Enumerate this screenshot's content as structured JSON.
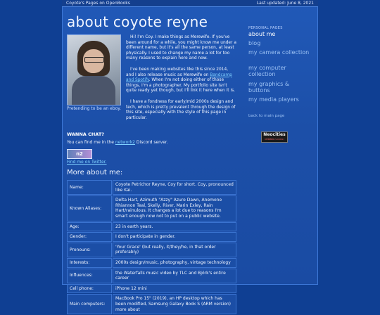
{
  "topbar": {
    "left": "Coyote's Pages on OpenBooks",
    "right": "Last updated: June 8, 2021"
  },
  "title": "about coyote reyne",
  "photo_caption": "Pretending to be an eboy.",
  "intro": {
    "p1": "Hi! I'm Coy. I make things as Merewife. If you've been around for a while, you might know me under a different name, but it's all the same person, at least physically. I used to change my name a lot for too many reasons to explain here and now.",
    "p2_a": "I've been making websites like this since 2014, and I also release music as Merewife on ",
    "p2_link": "Bandcamp and Spotify",
    "p2_b": ". When I'm not doing either of those things, I'm a photographer. My portfolio site isn't quite ready yet though, but I'll link it here when it is.",
    "p3": "I have a fondness for early/mid 2000s design and tech, which is pretty prevalent through the design of this site, especially with the style of this page in particular."
  },
  "chat": {
    "heading": "WANNA CHAT?",
    "text_a": "You can find me in the ",
    "link": "network2",
    "text_b": " Discord server.",
    "badge": "n2",
    "twitter": "Find me on Twitter."
  },
  "more_heading": "More about me:",
  "table": [
    {
      "k": "Name:",
      "v": "Coyote Petrichor Reyne, Coy for short. Coy, pronounced like Kai."
    },
    {
      "k": "Known Aliases:",
      "v": "Delta Hart, Azimuth \"Azzy\" Azure Dawn, Anemone Rhiannon Teal, Skelly, River, Marin Exley, Rain Hart/rainulous. It changes a lot due to reasons I'm smart enough now not to put on a public website."
    },
    {
      "k": "Age:",
      "v": "23 in earth years."
    },
    {
      "k": "Gender:",
      "v": "I don't participate in gender."
    },
    {
      "k": "Pronouns:",
      "v": "'Your Grace' (but really, it/they/he, in that order preferably)"
    },
    {
      "k": "Interests:",
      "v": "2000s design/music, photography, vintage technology"
    },
    {
      "k": "Influences:",
      "v": "the Waterfalls music video by TLC and Björk's entire career"
    },
    {
      "k": "Cell phone:",
      "v": "iPhone 12 mini"
    },
    {
      "k": "Main computers:",
      "v": "MacBook Pro 15\" (2019), an HP desktop which has been modified, Samsung Galaxy Book S (ARM version) more about"
    }
  ],
  "sidebar": {
    "heading": "PERSONAL PAGES",
    "items": [
      "about me",
      "blog",
      "my camera collection",
      "my computer collection",
      "my graphics & buttons",
      "my media players"
    ],
    "back": "back to main page",
    "neocities_a": "Neocities",
    "neocities_b": "MEMBER IS COOL!"
  },
  "colors": {
    "background": "#0f3f93",
    "panel": "#1c4fa8",
    "link": "#7fd0ff"
  }
}
